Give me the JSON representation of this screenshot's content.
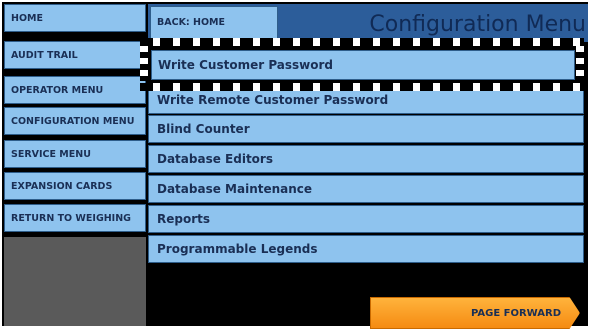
{
  "sidebar": {
    "items": [
      {
        "label": "HOME"
      },
      {
        "label": "AUDIT TRAIL"
      },
      {
        "label": "OPERATOR MENU"
      },
      {
        "label": "CONFIGURATION MENU"
      },
      {
        "label": "SERVICE MENU"
      },
      {
        "label": "EXPANSION CARDS"
      },
      {
        "label": "RETURN TO WEIGHING"
      }
    ]
  },
  "header": {
    "back_label": "BACK: HOME",
    "title": "Configuration Menu"
  },
  "menu": {
    "selected": "Write Customer Password",
    "items": [
      {
        "label": "Write Remote Customer Password"
      },
      {
        "label": "Blind Counter"
      },
      {
        "label": "Database Editors"
      },
      {
        "label": "Database Maintenance"
      },
      {
        "label": "Reports"
      },
      {
        "label": "Programmable Legends"
      }
    ]
  },
  "footer": {
    "page_forward_label": "PAGE FORWARD"
  },
  "colors": {
    "button_fill": "#8ec3ee",
    "header_fill": "#2c5d9a",
    "forward_fill": "#f58b12"
  }
}
